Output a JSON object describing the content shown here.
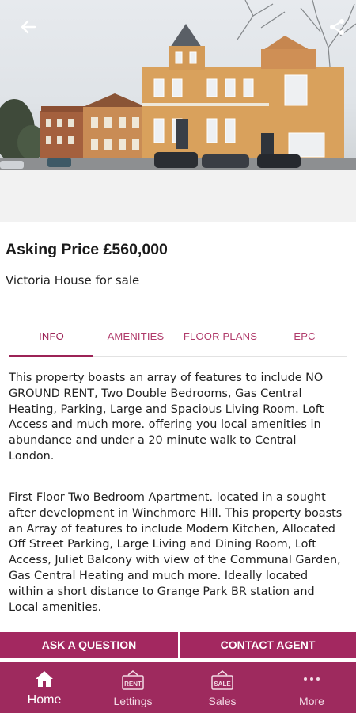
{
  "header": {
    "back_icon": "arrow-left-icon",
    "share_icon": "share-icon"
  },
  "listing": {
    "price": "Asking Price £560,000",
    "subtitle": "Victoria House for sale"
  },
  "tabs": [
    {
      "label": "INFO",
      "active": true
    },
    {
      "label": "AMENITIES",
      "active": false
    },
    {
      "label": "FLOOR PLANS",
      "active": false
    },
    {
      "label": "EPC",
      "active": false
    }
  ],
  "description": {
    "p1": "This property boasts an array of features to include NO GROUND RENT, Two Double Bedrooms, Gas Central Heating, Parking, Large and Spacious Living Room. Loft Access and much more. offering you local amenities in abundance and under a 20 minute walk to Central London.",
    "p2": "First Floor Two Bedroom Apartment. located in a sought after development in Winchmore Hill. This property boasts an Array of features to include Modern Kitchen, Allocated Off Street Parking, Large Living and Dining Room, Loft Access, Juliet Balcony with view of the Communal Garden, Gas Central Heating and much more. Ideally located within a short distance to Grange Park BR station and Local amenities."
  },
  "actions": {
    "ask": "ASK A QUESTION",
    "contact": "CONTACT AGENT"
  },
  "nav": [
    {
      "label": "Home",
      "icon": "home-icon",
      "active": true
    },
    {
      "label": "Lettings",
      "icon": "rent-sign-icon",
      "badge": "RENT",
      "active": false
    },
    {
      "label": "Sales",
      "icon": "sale-sign-icon",
      "badge": "SALE",
      "active": false
    },
    {
      "label": "More",
      "icon": "more-dots-icon",
      "active": false
    }
  ],
  "colors": {
    "brand": "#9e2a5e",
    "tab_text": "#b03a6a"
  }
}
